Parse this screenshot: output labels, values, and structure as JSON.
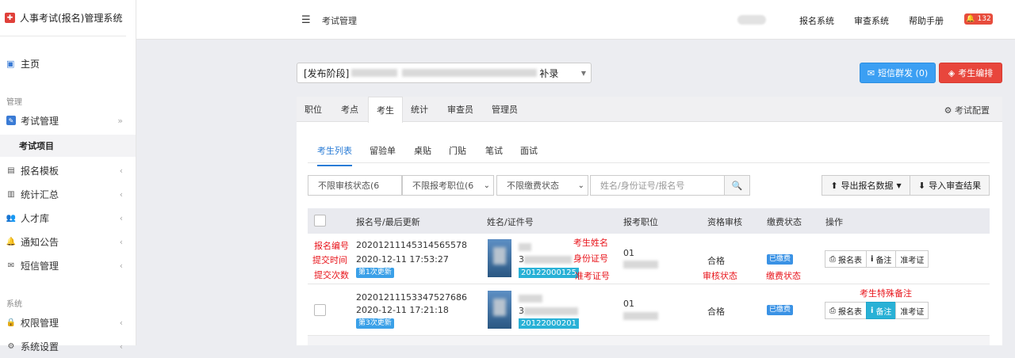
{
  "app": {
    "title": "人事考试(报名)管理系统"
  },
  "sidebar": {
    "home_label": "主页",
    "section_manage": "管理",
    "section_system": "系统",
    "items": [
      {
        "label": "考试管理",
        "icon": "edit-icon"
      },
      {
        "label": "报名模板",
        "icon": "template-icon"
      },
      {
        "label": "统计汇总",
        "icon": "bar-chart-icon"
      },
      {
        "label": "人才库",
        "icon": "users-icon"
      },
      {
        "label": "通知公告",
        "icon": "bell-icon"
      },
      {
        "label": "短信管理",
        "icon": "envelope-icon"
      },
      {
        "label": "权限管理",
        "icon": "lock-icon"
      },
      {
        "label": "系统设置",
        "icon": "gear-icon"
      }
    ],
    "sub_item": "考试项目"
  },
  "topbar": {
    "title": "考试管理",
    "links": [
      "报名系统",
      "审查系统",
      "帮助手册"
    ],
    "notification_count": "132"
  },
  "stage_select": {
    "prefix": "[发布阶段]",
    "suffix": "补录"
  },
  "actions": {
    "sms_label": "短信群发 (0)",
    "arrange_label": "考生编排"
  },
  "tabs_primary": [
    "职位",
    "考点",
    "考生",
    "统计",
    "审查员",
    "管理员"
  ],
  "tabs_primary_active": "考生",
  "exam_config_label": "考试配置",
  "tabs_secondary": [
    "考生列表",
    "留验单",
    "桌贴",
    "门贴",
    "笔试",
    "面试"
  ],
  "tabs_secondary_active": "考生列表",
  "filters": {
    "review_status": "不限审核状态(6",
    "position": "不限报考职位(6",
    "payment": "不限缴费状态",
    "search_placeholder": "姓名/身份证号/报名号",
    "export_label": "导出报名数据",
    "import_label": "导入审查结果"
  },
  "table": {
    "headers": [
      "报名号/最后更新",
      "姓名/证件号",
      "报考职位",
      "资格审核",
      "缴费状态",
      "操作"
    ],
    "rows": [
      {
        "reg_no": "20201211145314565578",
        "updated": "2020-12-11 17:53:27",
        "update_tag": "第1次更新",
        "name_partial": "",
        "id_partial": "3",
        "ticket": "20122000125",
        "position": "01",
        "review": "合格",
        "payment": "已缴费"
      },
      {
        "reg_no": "20201211153347527686",
        "updated": "2020-12-11 17:21:18",
        "update_tag": "第3次更新",
        "name_partial": "",
        "id_partial": "3",
        "ticket": "20122000201",
        "position": "01",
        "review": "合格",
        "payment": "已缴费"
      }
    ],
    "op_buttons": [
      "报名表",
      "备注",
      "准考证"
    ]
  },
  "annotations": {
    "reg_no": "报名编号",
    "submit_time": "提交时间",
    "submit_count": "提交次数",
    "name": "考生姓名",
    "id_no": "身份证号",
    "ticket": "准考证号",
    "review": "审核状态",
    "payment": "缴费状态",
    "special_note": "考生特殊备注"
  },
  "colors": {
    "primary": "#3b9ff3",
    "danger": "#e8463c",
    "info": "#29b1d6",
    "annotation": "#e8141b"
  }
}
